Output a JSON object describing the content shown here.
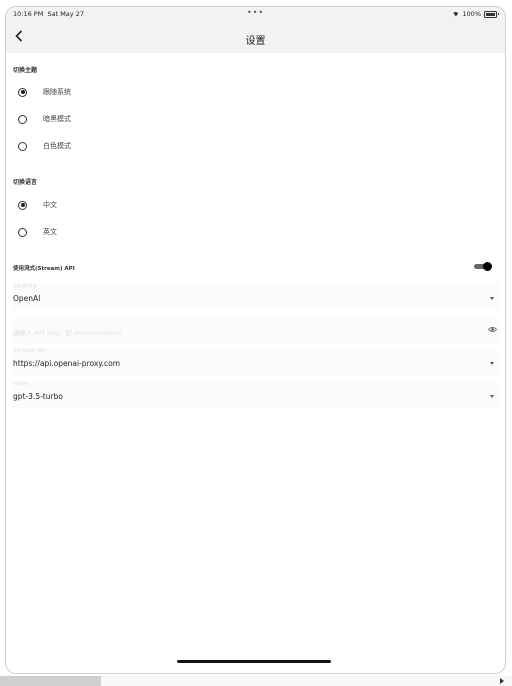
{
  "status": {
    "time": "10:16 PM",
    "date": "Sat May 27",
    "dots": "•••",
    "battery": "100%"
  },
  "nav": {
    "title": "设置",
    "back_icon": "chevron-left-icon"
  },
  "theme": {
    "header": "切换主题",
    "options": [
      {
        "label": "跟随系统",
        "selected": true
      },
      {
        "label": "暗黑模式",
        "selected": false
      },
      {
        "label": "白色模式",
        "selected": false
      }
    ]
  },
  "language": {
    "header": "切换语言",
    "options": [
      {
        "label": "中文",
        "selected": true
      },
      {
        "label": "英文",
        "selected": false
      }
    ]
  },
  "stream": {
    "label": "使用流式(Stream) API",
    "enabled": true
  },
  "fields": {
    "provider": {
      "label": "API 提供商",
      "value": "OpenAI"
    },
    "api_key": {
      "label": "",
      "placeholder": "请输入 API Key，如 sk-xxxxxxxxxx"
    },
    "base_url": {
      "label": "API Base URL",
      "value": "https://api.openai-proxy.com"
    },
    "model": {
      "label": "Model",
      "value": "gpt-3.5-turbo"
    }
  }
}
